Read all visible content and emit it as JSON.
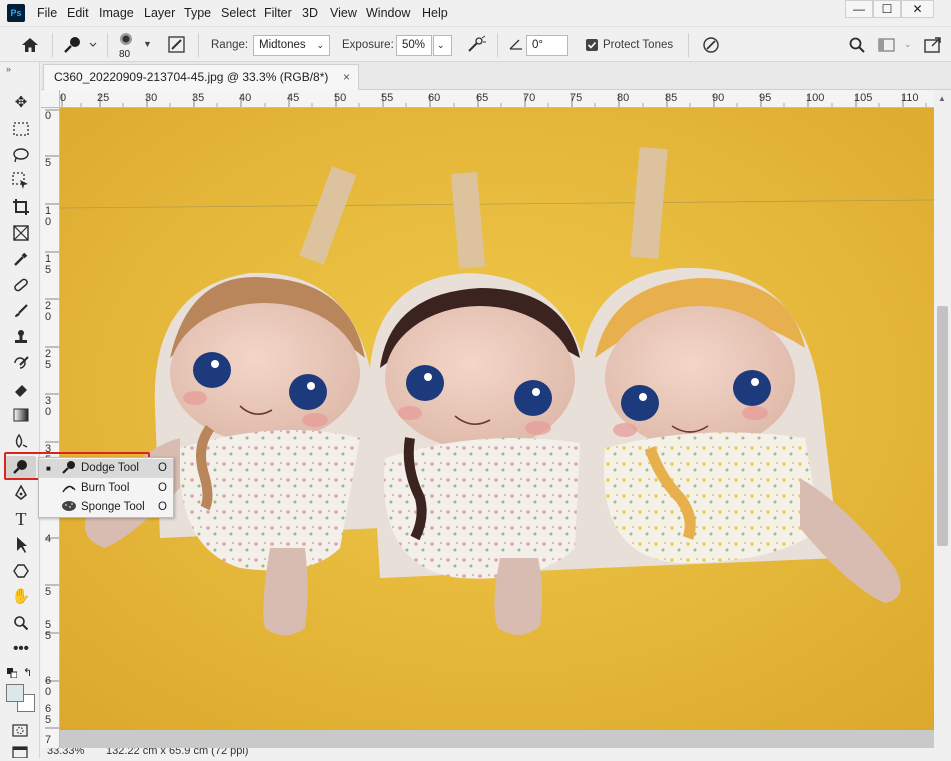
{
  "app": {
    "logo_text": "Ps"
  },
  "menu": [
    "File",
    "Edit",
    "Image",
    "Layer",
    "Type",
    "Select",
    "Filter",
    "3D",
    "View",
    "Window",
    "Help"
  ],
  "window_controls": {
    "minimize": "—",
    "maximize": "☐",
    "close": "✕"
  },
  "options": {
    "brush_size": "80",
    "range_label": "Range:",
    "range_value": "Midtones",
    "exposure_label": "Exposure:",
    "exposure_value": "50%",
    "angle_value": "0°",
    "protect_tones_label": "Protect Tones",
    "protect_tones_checked": true
  },
  "document": {
    "tab_title": "C360_20220909-213704-45.jpg @ 33.3% (RGB/8*)",
    "close_glyph": "×"
  },
  "ruler_h": [
    "0",
    "25",
    "30",
    "35",
    "40",
    "45",
    "50",
    "55",
    "60",
    "65",
    "70",
    "75",
    "80",
    "85",
    "90",
    "95",
    "100",
    "105",
    "110"
  ],
  "ruler_v": [
    "0",
    "5",
    "1\n0",
    "1\n5",
    "2\n0",
    "2\n5",
    "3\n0",
    "3\n5",
    "4",
    "4\n5",
    "5",
    "5\n5",
    "6\n0",
    "6\n5",
    "7"
  ],
  "flyout": [
    {
      "label": "Dodge Tool",
      "key": "O",
      "selected": true,
      "icon": "dodge-icon"
    },
    {
      "label": "Burn Tool",
      "key": "O",
      "selected": false,
      "icon": "burn-icon"
    },
    {
      "label": "Sponge Tool",
      "key": "O",
      "selected": false,
      "icon": "sponge-icon"
    }
  ],
  "status": {
    "zoom": "33.33%",
    "doc_size": "132.22 cm x 65.9 cm (72 ppi)"
  },
  "colors": {
    "background": "#e7b938",
    "highlight": "#d9261c"
  }
}
